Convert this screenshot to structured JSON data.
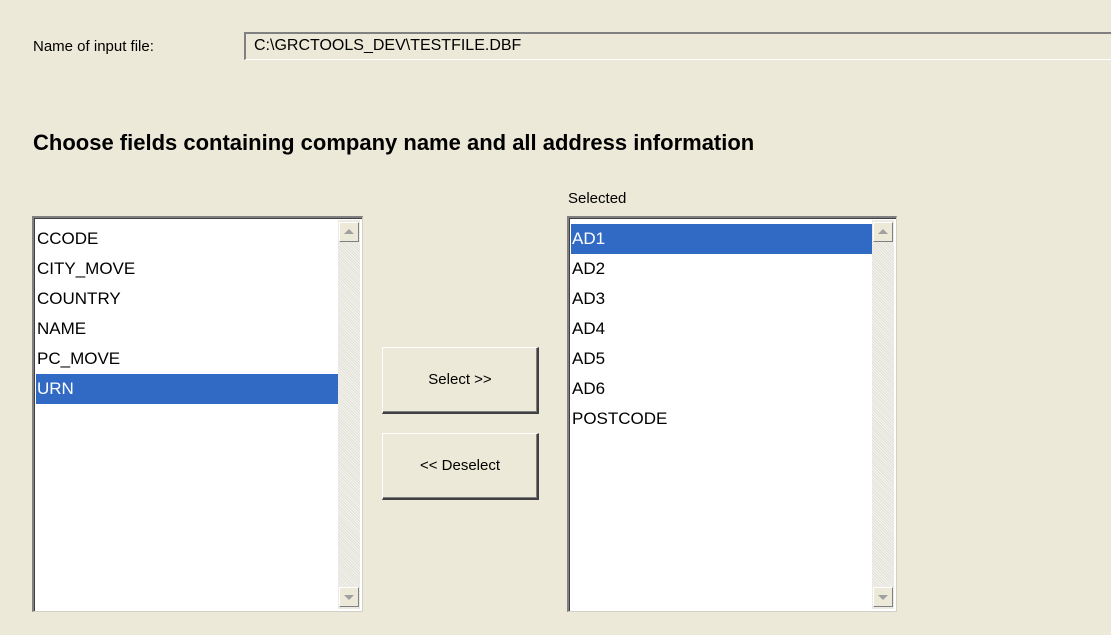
{
  "input_file": {
    "label": "Name of input file:",
    "value": "C:\\GRCTOOLS_DEV\\TESTFILE.DBF"
  },
  "heading": "Choose fields containing company name and all address information",
  "available": {
    "items": [
      "CCODE",
      "CITY_MOVE",
      "COUNTRY",
      "NAME",
      "PC_MOVE",
      "URN"
    ],
    "selected_item": "URN"
  },
  "selected": {
    "caption": "Selected",
    "items": [
      "AD1",
      "AD2",
      "AD3",
      "AD4",
      "AD5",
      "AD6",
      "POSTCODE"
    ],
    "selected_item": "AD1"
  },
  "buttons": {
    "select_label": "Select >>",
    "deselect_label": "<< Deselect"
  },
  "colors": {
    "background": "#ece9d8",
    "highlight": "#316ac5"
  },
  "icons": {
    "scroll_up": "scroll-up-arrow-icon",
    "scroll_down": "scroll-down-arrow-icon"
  }
}
